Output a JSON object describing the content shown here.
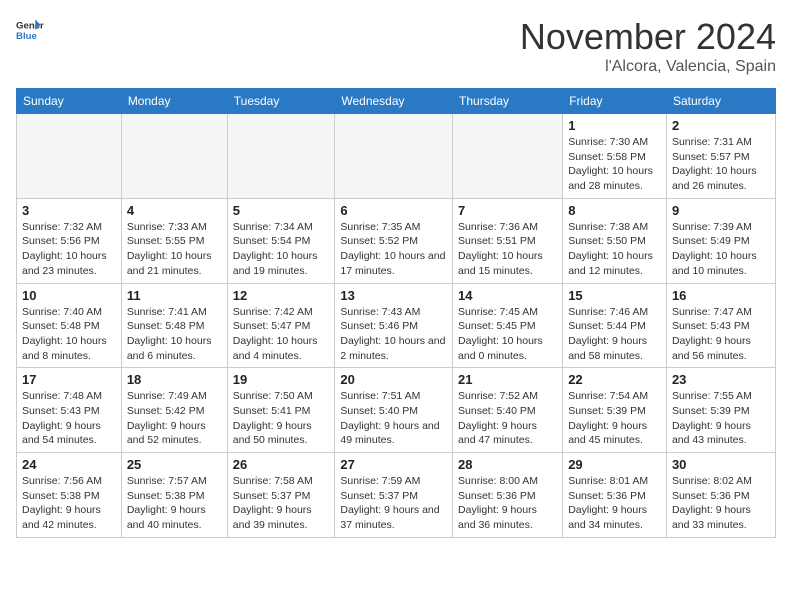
{
  "header": {
    "logo_line1": "General",
    "logo_line2": "Blue",
    "month_year": "November 2024",
    "location": "l'Alcora, Valencia, Spain"
  },
  "weekdays": [
    "Sunday",
    "Monday",
    "Tuesday",
    "Wednesday",
    "Thursday",
    "Friday",
    "Saturday"
  ],
  "weeks": [
    [
      {
        "day": "",
        "empty": true
      },
      {
        "day": "",
        "empty": true
      },
      {
        "day": "",
        "empty": true
      },
      {
        "day": "",
        "empty": true
      },
      {
        "day": "",
        "empty": true
      },
      {
        "day": "1",
        "sunrise": "7:30 AM",
        "sunset": "5:58 PM",
        "daylight": "10 hours and 28 minutes."
      },
      {
        "day": "2",
        "sunrise": "7:31 AM",
        "sunset": "5:57 PM",
        "daylight": "10 hours and 26 minutes."
      }
    ],
    [
      {
        "day": "3",
        "sunrise": "7:32 AM",
        "sunset": "5:56 PM",
        "daylight": "10 hours and 23 minutes."
      },
      {
        "day": "4",
        "sunrise": "7:33 AM",
        "sunset": "5:55 PM",
        "daylight": "10 hours and 21 minutes."
      },
      {
        "day": "5",
        "sunrise": "7:34 AM",
        "sunset": "5:54 PM",
        "daylight": "10 hours and 19 minutes."
      },
      {
        "day": "6",
        "sunrise": "7:35 AM",
        "sunset": "5:52 PM",
        "daylight": "10 hours and 17 minutes."
      },
      {
        "day": "7",
        "sunrise": "7:36 AM",
        "sunset": "5:51 PM",
        "daylight": "10 hours and 15 minutes."
      },
      {
        "day": "8",
        "sunrise": "7:38 AM",
        "sunset": "5:50 PM",
        "daylight": "10 hours and 12 minutes."
      },
      {
        "day": "9",
        "sunrise": "7:39 AM",
        "sunset": "5:49 PM",
        "daylight": "10 hours and 10 minutes."
      }
    ],
    [
      {
        "day": "10",
        "sunrise": "7:40 AM",
        "sunset": "5:48 PM",
        "daylight": "10 hours and 8 minutes."
      },
      {
        "day": "11",
        "sunrise": "7:41 AM",
        "sunset": "5:48 PM",
        "daylight": "10 hours and 6 minutes."
      },
      {
        "day": "12",
        "sunrise": "7:42 AM",
        "sunset": "5:47 PM",
        "daylight": "10 hours and 4 minutes."
      },
      {
        "day": "13",
        "sunrise": "7:43 AM",
        "sunset": "5:46 PM",
        "daylight": "10 hours and 2 minutes."
      },
      {
        "day": "14",
        "sunrise": "7:45 AM",
        "sunset": "5:45 PM",
        "daylight": "10 hours and 0 minutes."
      },
      {
        "day": "15",
        "sunrise": "7:46 AM",
        "sunset": "5:44 PM",
        "daylight": "9 hours and 58 minutes."
      },
      {
        "day": "16",
        "sunrise": "7:47 AM",
        "sunset": "5:43 PM",
        "daylight": "9 hours and 56 minutes."
      }
    ],
    [
      {
        "day": "17",
        "sunrise": "7:48 AM",
        "sunset": "5:43 PM",
        "daylight": "9 hours and 54 minutes."
      },
      {
        "day": "18",
        "sunrise": "7:49 AM",
        "sunset": "5:42 PM",
        "daylight": "9 hours and 52 minutes."
      },
      {
        "day": "19",
        "sunrise": "7:50 AM",
        "sunset": "5:41 PM",
        "daylight": "9 hours and 50 minutes."
      },
      {
        "day": "20",
        "sunrise": "7:51 AM",
        "sunset": "5:40 PM",
        "daylight": "9 hours and 49 minutes."
      },
      {
        "day": "21",
        "sunrise": "7:52 AM",
        "sunset": "5:40 PM",
        "daylight": "9 hours and 47 minutes."
      },
      {
        "day": "22",
        "sunrise": "7:54 AM",
        "sunset": "5:39 PM",
        "daylight": "9 hours and 45 minutes."
      },
      {
        "day": "23",
        "sunrise": "7:55 AM",
        "sunset": "5:39 PM",
        "daylight": "9 hours and 43 minutes."
      }
    ],
    [
      {
        "day": "24",
        "sunrise": "7:56 AM",
        "sunset": "5:38 PM",
        "daylight": "9 hours and 42 minutes."
      },
      {
        "day": "25",
        "sunrise": "7:57 AM",
        "sunset": "5:38 PM",
        "daylight": "9 hours and 40 minutes."
      },
      {
        "day": "26",
        "sunrise": "7:58 AM",
        "sunset": "5:37 PM",
        "daylight": "9 hours and 39 minutes."
      },
      {
        "day": "27",
        "sunrise": "7:59 AM",
        "sunset": "5:37 PM",
        "daylight": "9 hours and 37 minutes."
      },
      {
        "day": "28",
        "sunrise": "8:00 AM",
        "sunset": "5:36 PM",
        "daylight": "9 hours and 36 minutes."
      },
      {
        "day": "29",
        "sunrise": "8:01 AM",
        "sunset": "5:36 PM",
        "daylight": "9 hours and 34 minutes."
      },
      {
        "day": "30",
        "sunrise": "8:02 AM",
        "sunset": "5:36 PM",
        "daylight": "9 hours and 33 minutes."
      }
    ]
  ]
}
